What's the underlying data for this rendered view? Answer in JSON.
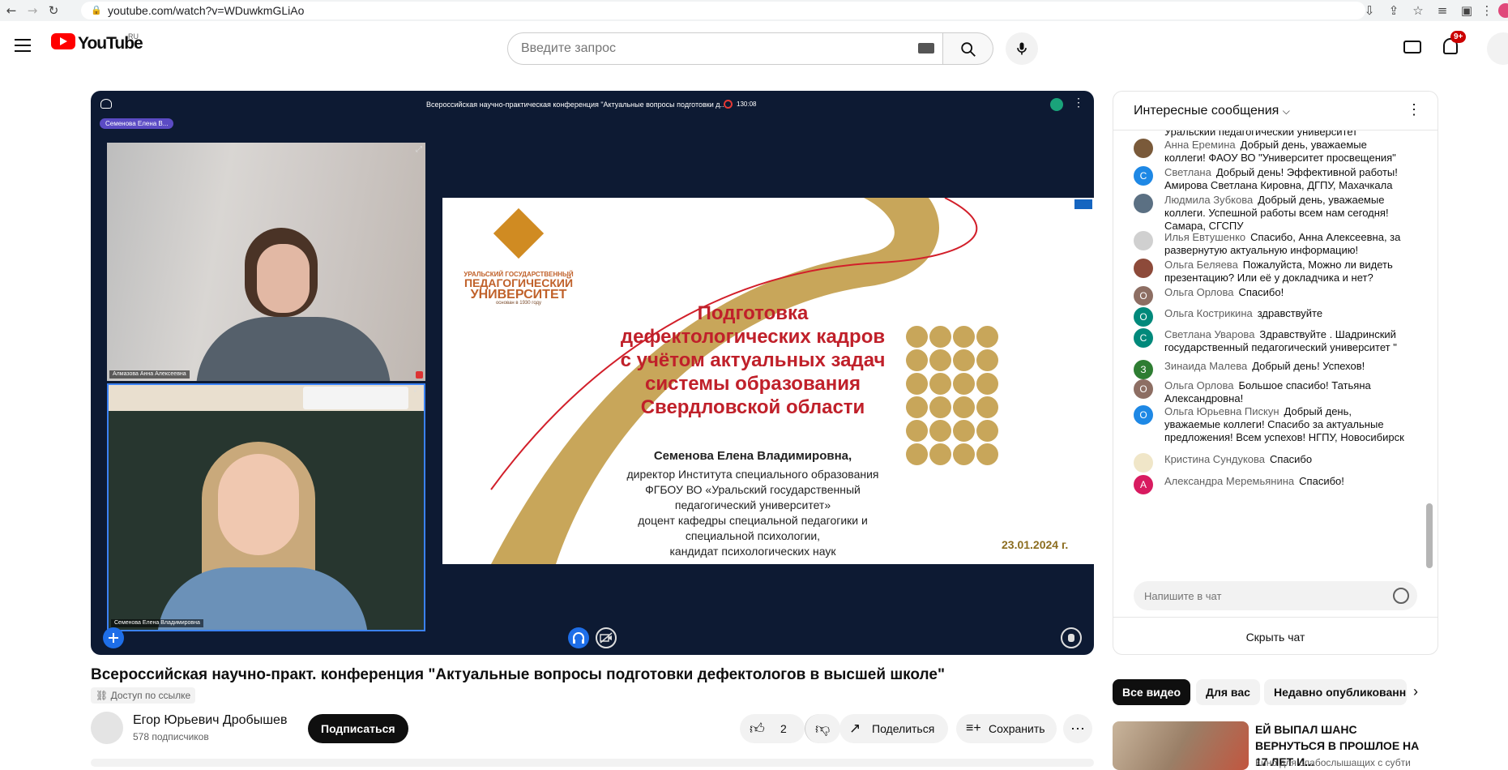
{
  "browser": {
    "url": "youtube.com/watch?v=WDuwkmGLiAo"
  },
  "header": {
    "logo_text": "YouTube",
    "region": "RU",
    "search_placeholder": "Введите запрос",
    "notifications_badge": "9+"
  },
  "player": {
    "conference_title": "Всероссийская научно-практическая конференция \"Актуальные вопросы подготовки д...",
    "recording_time": "130:08",
    "speaker_tag": "Семенова Елена В...",
    "cam1_label": "Алмазова Анна Алексеевна",
    "cam2_label": "Семенова Елена Владимировна",
    "slide": {
      "uni_line1": "УРАЛЬСКИЙ ГОСУДАРСТВЕННЫЙ",
      "uni_line2": "ПЕДАГОГИЧЕСКИЙ",
      "uni_line3": "УНИВЕРСИТЕТ",
      "uni_founded": "основан в 1930 году",
      "title": [
        "Подготовка",
        "дефектологических кадров",
        "с учётом актуальных задач",
        "системы образования",
        "Свердловской области"
      ],
      "author": "Семенова Елена Владимировна,",
      "lines": [
        "директор Института специального образования",
        "ФГБОУ ВО «Уральский государственный",
        "педагогический университет»",
        "доцент кафедры специальной педагогики и",
        "специальной психологии,",
        "кандидат психологических наук"
      ],
      "date": "23.01.2024 г."
    }
  },
  "chat": {
    "title": "Интересные сообщения",
    "partial_top": "Уральский педагогический университет",
    "messages": [
      {
        "author": "Анна Еремина",
        "text": "Добрый день, уважаемые коллеги! ФАОУ ВО \"Университет просвещения\"",
        "initial": "",
        "color": "#7a5a3a"
      },
      {
        "author": "Светлана",
        "text": "Добрый день! Эффективной работы! Амирова Светлана Кировна, ДГПУ, Махачкала",
        "initial": "С",
        "color": "#1e88e5"
      },
      {
        "author": "Людмила Зубкова",
        "text": "Добрый день, уважаемые коллеги. Успешной работы всем нам сегодня! Самара, СГСПУ",
        "initial": "",
        "color": "#5b7083"
      },
      {
        "author": "Илья Евтушенко",
        "text": "Спасибо, Анна Алексеевна, за развернутую актуальную информацию!",
        "initial": "",
        "color": "#d0d0d0"
      },
      {
        "author": "Ольга Беляева",
        "text": "Пожалуйста, Можно ли видеть презентацию? Или её у докладчика и нет?",
        "initial": "",
        "color": "#8d4a3a"
      },
      {
        "author": "Ольга Орлова",
        "text": "Спасибо!",
        "initial": "О",
        "color": "#8d6e63"
      },
      {
        "author": "Ольга Кострикина",
        "text": "здравствуйте",
        "initial": "О",
        "color": "#00897b"
      },
      {
        "author": "Светлана Уварова",
        "text": "Здравствуйте . Шадринский государственный педагогический университет \"",
        "initial": "С",
        "color": "#00897b"
      },
      {
        "author": "Зинаида Малева",
        "text": "Добрый день! Успехов!",
        "initial": "З",
        "color": "#2e7d32"
      },
      {
        "author": "Ольга Орлова",
        "text": "Большое спасибо! Татьяна Александровна!",
        "initial": "О",
        "color": "#8d6e63"
      },
      {
        "author": "Ольга Юрьевна Пискун",
        "text": "Добрый день, уважаемые коллеги! Спасибо за актуальные предложения! Всем успехов! НГПУ, Новосибирск",
        "initial": "О",
        "color": "#1e88e5"
      },
      {
        "author": "Кристина Сундукова",
        "text": "Спасибо",
        "initial": "",
        "color": "#f0e6c8"
      },
      {
        "author": "Александра Меремьянина",
        "text": "Спасибо!",
        "initial": "А",
        "color": "#d81b60"
      }
    ],
    "input_placeholder": "Напишите в чат",
    "hide_label": "Скрыть чат"
  },
  "video": {
    "title": "Всероссийская научно-практ. конференция \"Актуальные вопросы подготовки дефектологов в высшей школе\"",
    "access": "Доступ по ссылке",
    "channel": "Егор Юрьевич Дробышев",
    "subscribers": "578 подписчиков",
    "subscribe_label": "Подписаться",
    "likes": "2",
    "share_label": "Поделиться",
    "save_label": "Сохранить"
  },
  "recommendations": {
    "tabs": [
      "Все видео",
      "Для вас",
      "Недавно опубликованн"
    ],
    "item_title": "ЕЙ ВЫПАЛ ШАНС ВЕРНУТЬСЯ В ПРОШЛОЕ НА 17 ЛЕТ И...",
    "item_channel": "Кино для слабослышащих с субти"
  }
}
